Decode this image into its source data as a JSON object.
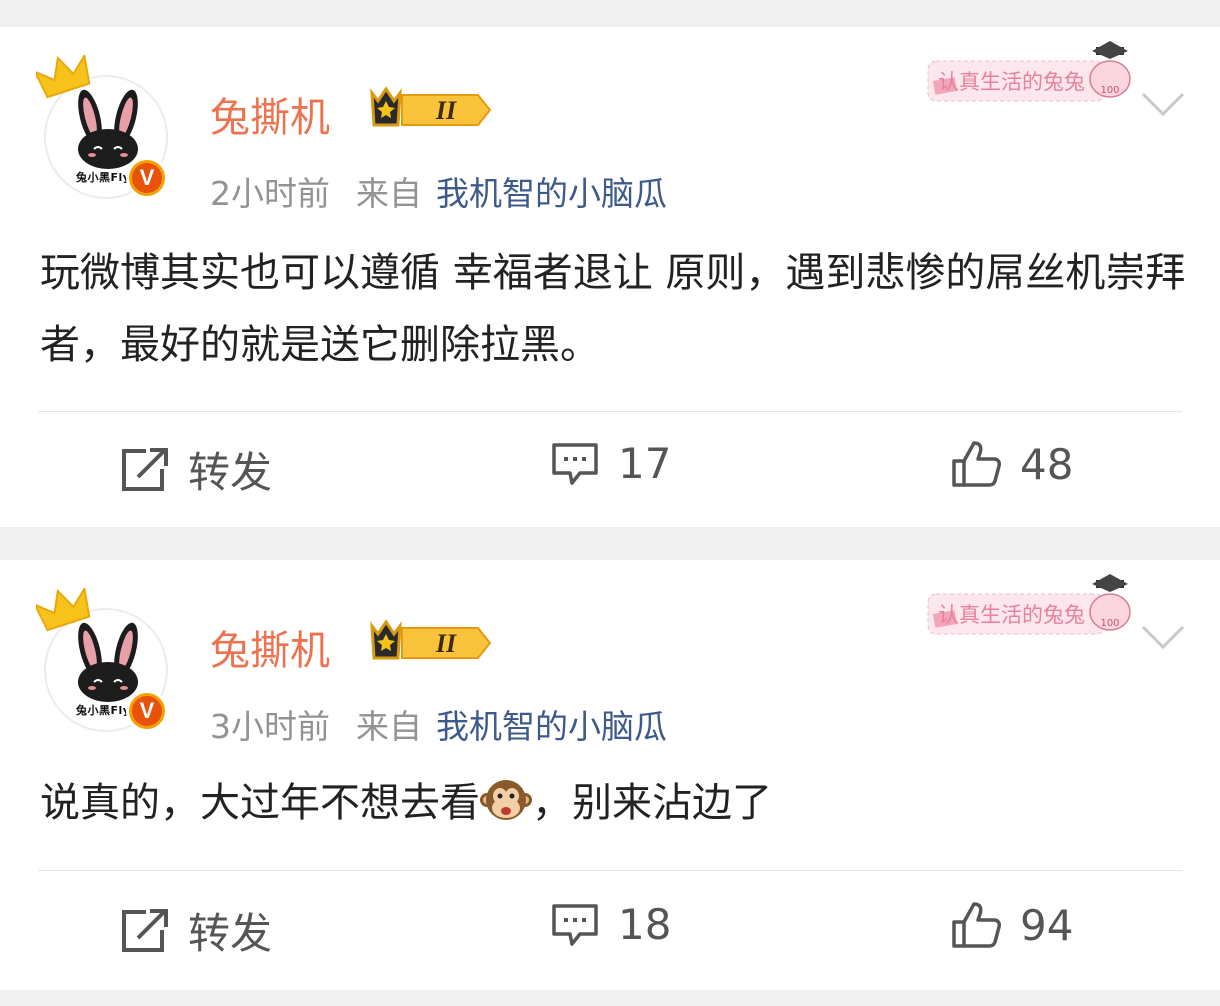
{
  "posts": [
    {
      "avatar_text": "兔小黑Flyi",
      "username": "兔撕机",
      "vip_level": "II",
      "time": "2小时前",
      "from_label": "来自",
      "source": "我机智的小脑瓜",
      "sticker_text": "认真生活的兔兔",
      "sticker_badge": "100",
      "content": "玩微博其实也可以遵循 幸福者退让 原则，遇到悲惨的屌丝机崇拜者，最好的就是送它删除拉黑。",
      "repost_label": "转发",
      "comments": "17",
      "likes": "48"
    },
    {
      "avatar_text": "兔小黑Flyi",
      "username": "兔撕机",
      "vip_level": "II",
      "time": "3小时前",
      "from_label": "来自",
      "source": "我机智的小脑瓜",
      "sticker_text": "认真生活的兔兔",
      "sticker_badge": "100",
      "content_before": "说真的，大过年不想去看",
      "content_after": "，别来沾边了",
      "repost_label": "转发",
      "comments": "18",
      "likes": "94"
    }
  ],
  "colors": {
    "username": "#eb7350",
    "source_link": "#3d5a8a",
    "meta": "#939393",
    "background": "#f0f0f0"
  },
  "icons": {
    "repost": "repost-icon",
    "comment": "comment-icon",
    "like": "like-icon",
    "crown": "crown-icon",
    "verified": "verified-badge-icon",
    "more": "chevron-down-icon",
    "emoji": "monkey-emoji-icon"
  }
}
